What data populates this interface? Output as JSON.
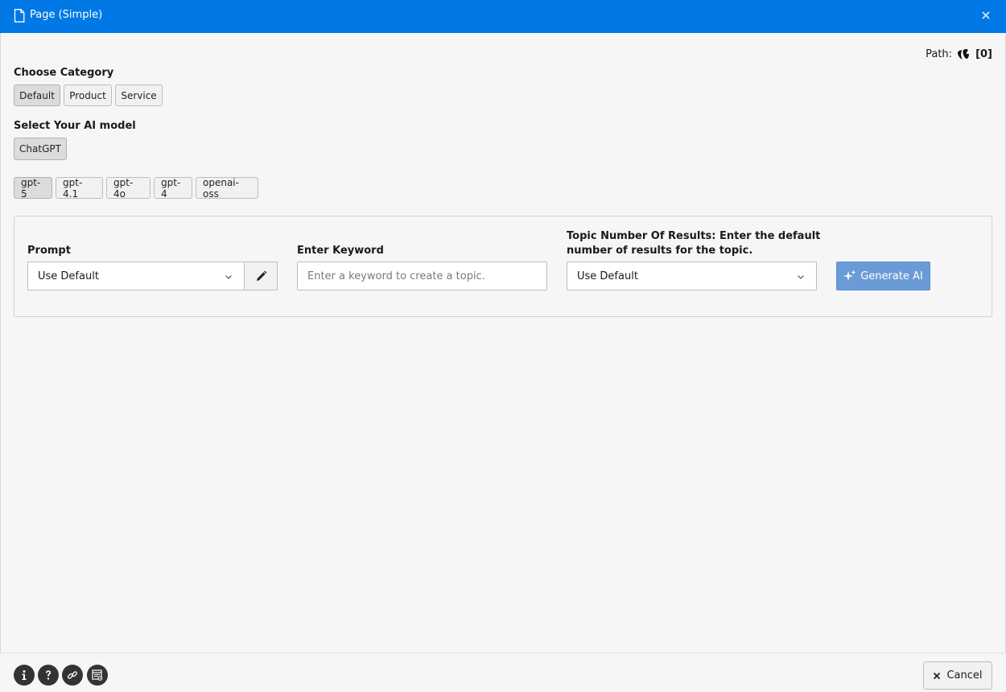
{
  "window": {
    "title": "Page (Simple)",
    "accent_color": "#0078e6",
    "close_icon": "close-icon",
    "title_icon": "document-icon"
  },
  "path": {
    "label": "Path:",
    "icon": "typo3-logo-icon",
    "value": "[0]"
  },
  "category": {
    "heading": "Choose Category",
    "options": [
      "Default",
      "Product",
      "Service"
    ],
    "selected": "Default"
  },
  "ai_model": {
    "heading": "Select Your AI model",
    "providers": [
      "ChatGPT"
    ],
    "selected_provider": "ChatGPT",
    "models": [
      "gpt-5",
      "gpt-4.1",
      "gpt-4o",
      "gpt-4",
      "openai-oss"
    ],
    "selected_model": "gpt-5"
  },
  "form": {
    "prompt": {
      "label": "Prompt",
      "value": "Use Default",
      "edit_icon": "pencil-icon"
    },
    "keyword": {
      "label": "Enter Keyword",
      "placeholder": "Enter a keyword to create a topic.",
      "value": ""
    },
    "results": {
      "label_line1": "Topic Number Of Results: Enter the default",
      "label_line2": "number of results for the topic.",
      "value": "Use Default"
    },
    "generate": {
      "label": "Generate AI",
      "icon": "sparkles-icon",
      "color": "#6b9bd6"
    }
  },
  "footer": {
    "icons": [
      "info-icon",
      "help-icon",
      "link-icon",
      "preview-icon"
    ],
    "cancel_label": "Cancel",
    "cancel_icon": "close-icon"
  }
}
